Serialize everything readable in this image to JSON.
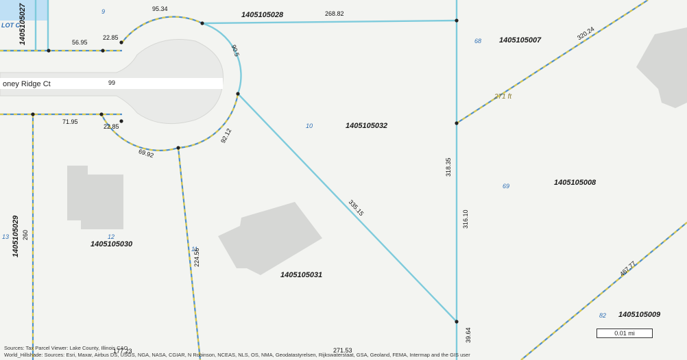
{
  "map": {
    "road_name": "oney Ridge Ct",
    "measure_label": "271 ft",
    "lot_c_label": "LOT C",
    "parcels": [
      {
        "key": "p1",
        "id": "1405105027"
      },
      {
        "key": "p2",
        "id": "1405105028"
      },
      {
        "key": "p3",
        "id": "1405105007"
      },
      {
        "key": "p4",
        "id": "1405105032"
      },
      {
        "key": "p5",
        "id": "1405105008"
      },
      {
        "key": "p6",
        "id": "1405105029"
      },
      {
        "key": "p7",
        "id": "1405105030"
      },
      {
        "key": "p8",
        "id": "1405105031"
      },
      {
        "key": "p9",
        "id": "1405105009"
      }
    ],
    "lot_numbers": [
      "9",
      "68",
      "10",
      "69",
      "13",
      "12",
      "11",
      "82"
    ],
    "dimensions": [
      "95.34",
      "268.82",
      "56.95",
      "22.85",
      "90.5",
      "320.24",
      "99",
      "71.95",
      "22.85",
      "92.12",
      "69.92",
      "318.35",
      "335.15",
      "316.10",
      "260",
      "224.56",
      "177.23",
      "271.53",
      "39.64",
      "467.77"
    ],
    "scale_label": "0.01 mi",
    "attribution_line1": "Sources: Tax Parcel Viewer: Lake County, Illinois CAO",
    "attribution_line2": "World_Hillshade: Sources: Esri, Maxar, Airbus DS, USGS, NGA, NASA, CGIAR, N Robinson, NCEAS, NLS, OS, NMA, Geodatastyrelsen, Rijkswaterstaat, GSA, Geoland, FEMA, Intermap and the GIS user"
  }
}
